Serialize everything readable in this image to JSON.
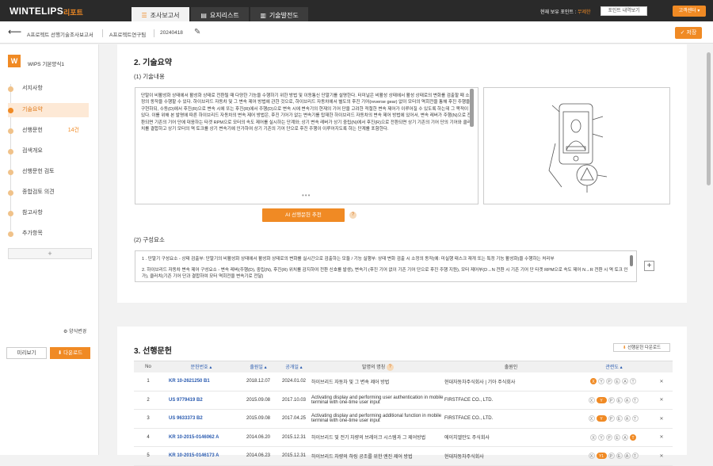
{
  "brand": {
    "name": "WINTELIPS",
    "sub": "리포트"
  },
  "tabs": [
    {
      "label": "조사보고서",
      "icon": "list-icon",
      "active": true
    },
    {
      "label": "요지리스트",
      "icon": "doc-icon",
      "active": false
    },
    {
      "label": "기술발전도",
      "icon": "chart-icon",
      "active": false
    }
  ],
  "points": {
    "label": "현재 보유 포인트 :",
    "value": "무제한"
  },
  "point_history": "포인트 내역보기",
  "customer_center": "고객센터",
  "subbar": {
    "project": "A프로젝트 선행기술조사보고서",
    "team": "A프로젝트연구팀",
    "date": "20240418",
    "save": "저장"
  },
  "sidebar": {
    "logo": "W",
    "template": "WIPS 기본양식1",
    "items": [
      {
        "label": "서지사항",
        "count": ""
      },
      {
        "label": "기술요약",
        "count": ""
      },
      {
        "label": "선행문헌",
        "count": "14건"
      },
      {
        "label": "검색개요",
        "count": ""
      },
      {
        "label": "선행문헌 검토",
        "count": ""
      },
      {
        "label": "종합검토 의견",
        "count": ""
      },
      {
        "label": "참고사항",
        "count": ""
      },
      {
        "label": "추가항목",
        "count": ""
      }
    ],
    "add": "+",
    "format_change": "양식변경",
    "preview": "미리보기",
    "download": "다운로드"
  },
  "summary": {
    "title": "2. 기술요약",
    "content_label": "(1) 기술내용",
    "content": "단말이 비활성화 상태에서 활성화 상태로 전환될 때 다양한 기능을 수행하기 위한 방법 및 이동통신 단말기를 설명한다. 터미널은 비활성 상태에서 활성 상태로의 변화를 검출할 때 소정의 동작을 수행할 수 있다. 하이브리드 자동차 및 그 변속 제어 방법에 관한 것으로, 하이브리드 자동차에서 별도의 후진 기어(reverse gear) 없이 모터의 역회전을 통해 후진 주행을 구현하되, 수동(D)에서 후진(R)으로 변속 시에 또는 후진(R)에서 주행(D)으로 변속 시에 변속기의 현재의 기어 단을 고려한 적절한 변속 제어가 이루어질 수 있도록 하는데 그 목적이 있다. 이를 위해 본 발명에 따른 하이브리드 자동차의 변속 제어 방법은, 후진 기어가 없는 변속기를 탑재한 하이브리드 자동차의 변속 제어 방법에 있어서, 변속 레버가 주행(N)으로 전환되면 기존의 기어 단에 대응하는 타겟 RPM으로 모터의 속도 제어를 실시하는 단계와; 상기 변속 레버가 상기 중립(N)에서 후진(R)으로 전환되면 상기 기존의 기어 단의 기어와 클러치를 결합하고 상기 모터의 역 토크를 상기 변속기에 인가하여 상기 기존의 기어 단으로 후진 주행이 이루어지도록 하는 단계를 포함한다.",
    "more": "•••",
    "ai_button": "AI 선행문헌 추천",
    "components_label": "(2) 구성요소",
    "components": [
      "1 . 단말기 구성요소 - 상태 검출부: 단말기의 비활성화 상태에서 활성화 상태로의 변화를 실시간으로 검출하는 모듈 / 기능 실행부: 상태 변화 검출 시 소정의 동작(예: 미실행 태스크 재개 또는 특정 기능 활성화)을 수행하는 처리부",
      "2. 하이브리드 자동차 변속 제어 구성요소 - 변속 레버(주행(D), 중립(N), 후진(R) 위치를 감지하여 전환 신호를 발생), 변속기 (후진 기어 없이 기존 기어 단으로 후진 주행 지원), 모터 제어부(D→N 전환 시 기존 기어 단 타겟 RPM으로 속도 제어 N→R 전환 시 역 토크 인가), 클러치(기존 기어 단과 결합하여 모터 역회전을 변속기로 전달)"
    ]
  },
  "prior": {
    "title": "3. 선행문헌",
    "download": "선행문헌 다운로드",
    "headers": [
      "No",
      "문헌번호",
      "출원일",
      "공개일",
      "발명의 명칭",
      "출원인",
      "관련도"
    ],
    "rows": [
      {
        "no": "1",
        "number": "KR 10-2621250 B1",
        "filed": "2018.12.07",
        "published": "2024.01.02",
        "title": "하이브리드 자동차 및 그 변속 제어 방법",
        "applicant": "현대자동차주식회사 | 기아 주식회사",
        "rel": [
          "X",
          "Y",
          "P",
          "E",
          "A",
          "T"
        ],
        "on": "X"
      },
      {
        "no": "2",
        "number": "US 9779419 B2",
        "filed": "2015.09.08",
        "published": "2017.10.03",
        "title": "Activating display and performing user authentication in mobile terminal with one-time user input",
        "applicant": "FIRSTFACE CO., LTD.",
        "rel": [
          "X",
          "Y",
          "P",
          "E",
          "A",
          "T"
        ],
        "on": "Y"
      },
      {
        "no": "3",
        "number": "US 9633373 B2",
        "filed": "2015.09.08",
        "published": "2017.04.25",
        "title": "Activating display and performing additional function in mobile terminal with one-time user input",
        "applicant": "FIRSTFACE CO., LTD.",
        "rel": [
          "X",
          "Y",
          "P",
          "E",
          "A",
          "T"
        ],
        "on": "Y"
      },
      {
        "no": "4",
        "number": "KR 10-2015-0146062 A",
        "filed": "2014.06.20",
        "published": "2015.12.31",
        "title": "하이브리드 및 전기 차량의 브레이크 시스템과 그 제어방법",
        "applicant": "에이치엘만도 주식회사",
        "rel": [
          "X",
          "Y",
          "P",
          "E",
          "A",
          "T"
        ],
        "on": "T"
      },
      {
        "no": "5",
        "number": "KR 10-2015-0146173 A",
        "filed": "2014.06.23",
        "published": "2015.12.31",
        "title": "하이브리드 차량의 하링 공조를 위한 엔진 제어 방법",
        "applicant": "현대자동차주식회사",
        "rel": [
          "X",
          "Y1",
          "P",
          "E",
          "A",
          "T"
        ],
        "on": "Y1"
      }
    ]
  }
}
